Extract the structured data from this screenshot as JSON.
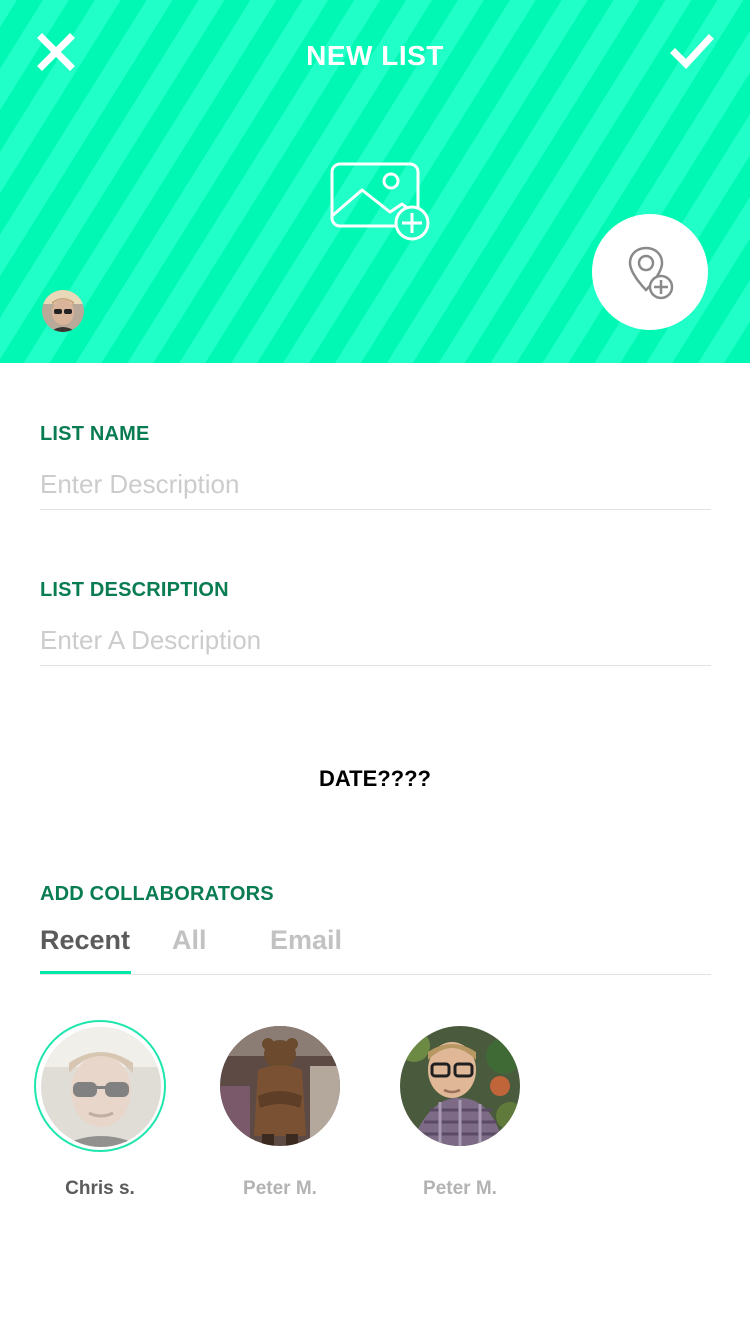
{
  "header": {
    "title": "NEW LIST",
    "close_icon": "close-icon",
    "confirm_icon": "checkmark-icon",
    "add_image_icon": "image-add-icon",
    "add_location_icon": "location-pin-add-icon",
    "accent_color": "#00ffbb"
  },
  "form": {
    "list_name": {
      "label": "LIST NAME",
      "placeholder": "Enter Description",
      "value": ""
    },
    "list_description": {
      "label": "LIST DESCRIPTION",
      "placeholder": "Enter A Description",
      "value": ""
    },
    "date_label": "DATE????"
  },
  "collaborators": {
    "heading": "ADD COLLABORATORS",
    "tabs": [
      {
        "label": "Recent",
        "active": true
      },
      {
        "label": "All",
        "active": false
      },
      {
        "label": "Email",
        "active": false
      }
    ],
    "people": [
      {
        "name": "Chris s.",
        "selected": true
      },
      {
        "name": "Peter M.",
        "selected": false
      },
      {
        "name": "Peter M.",
        "selected": false
      }
    ]
  }
}
